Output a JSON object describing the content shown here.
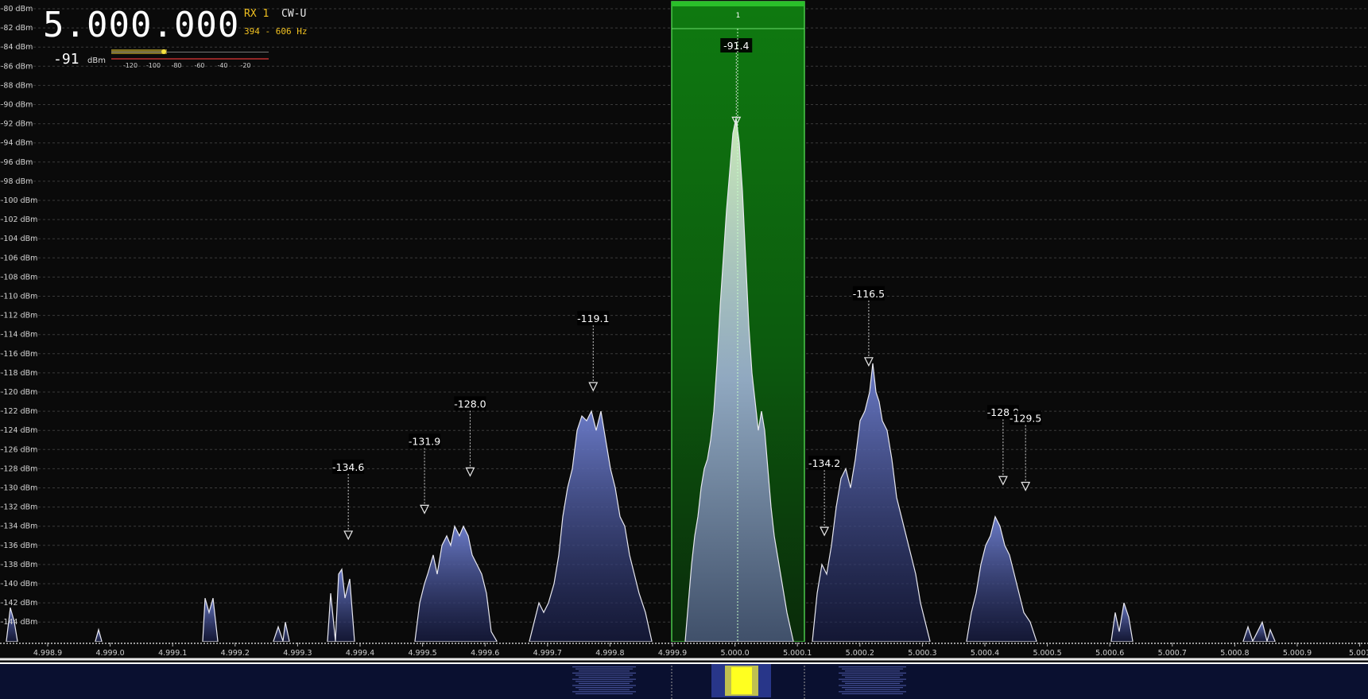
{
  "header": {
    "frequency": "5.000.000",
    "rx_label": "RX 1",
    "mode": "CW-U",
    "filter_bandwidth": "394 - 606 Hz"
  },
  "smeter": {
    "value": "-91",
    "unit": "dBm",
    "level_dbm": -91,
    "scale": [
      "-120",
      "-100",
      "-80",
      "-60",
      "-40",
      "-20"
    ]
  },
  "y_axis": {
    "labels": [
      "-80 dBm",
      "-82 dBm",
      "-84 dBm",
      "-86 dBm",
      "-88 dBm",
      "-90 dBm",
      "-92 dBm",
      "-94 dBm",
      "-96 dBm",
      "-98 dBm",
      "-100 dBm",
      "-102 dBm",
      "-104 dBm",
      "-106 dBm",
      "-108 dBm",
      "-110 dBm",
      "-112 dBm",
      "-114 dBm",
      "-116 dBm",
      "-118 dBm",
      "-120 dBm",
      "-122 dBm",
      "-124 dBm",
      "-126 dBm",
      "-128 dBm",
      "-130 dBm",
      "-132 dBm",
      "-134 dBm",
      "-136 dBm",
      "-138 dBm",
      "-140 dBm",
      "-142 dBm",
      "-144 dBm"
    ]
  },
  "x_axis": {
    "labels": [
      "4.998.9",
      "4.999.0",
      "4.999.1",
      "4.999.2",
      "4.999.3",
      "4.999.4",
      "4.999.5",
      "4.999.6",
      "4.999.7",
      "4.999.8",
      "4.999.9",
      "5.000.0",
      "5.000.1",
      "5.000.2",
      "5.000.3",
      "5.000.4",
      "5.000.5",
      "5.000.6",
      "5.000.7",
      "5.000.8",
      "5.000.9",
      "5.001"
    ]
  },
  "passband": {
    "label": "1",
    "color": "#1a8a1a"
  },
  "peaks": [
    {
      "label": "-91.4",
      "freq_mhz": 5.000002,
      "dbm": -91.4
    },
    {
      "label": "-134.6",
      "freq_mhz": 4.999381,
      "dbm": -134.6
    },
    {
      "label": "-131.9",
      "freq_mhz": 4.999503,
      "dbm": -131.9
    },
    {
      "label": "-128.0",
      "freq_mhz": 4.999576,
      "dbm": -128.0
    },
    {
      "label": "-119.1",
      "freq_mhz": 4.999773,
      "dbm": -119.1
    },
    {
      "label": "-134.2",
      "freq_mhz": 5.000143,
      "dbm": -134.2
    },
    {
      "label": "-116.5",
      "freq_mhz": 5.000214,
      "dbm": -116.5
    },
    {
      "label": "-128.9",
      "freq_mhz": 5.000429,
      "dbm": -128.9
    },
    {
      "label": "-129.5",
      "freq_mhz": 5.000465,
      "dbm": -129.5
    }
  ],
  "colors": {
    "accent": "#f0c020",
    "trace": "#e8e8f0",
    "fill": "#5a6ab8"
  }
}
